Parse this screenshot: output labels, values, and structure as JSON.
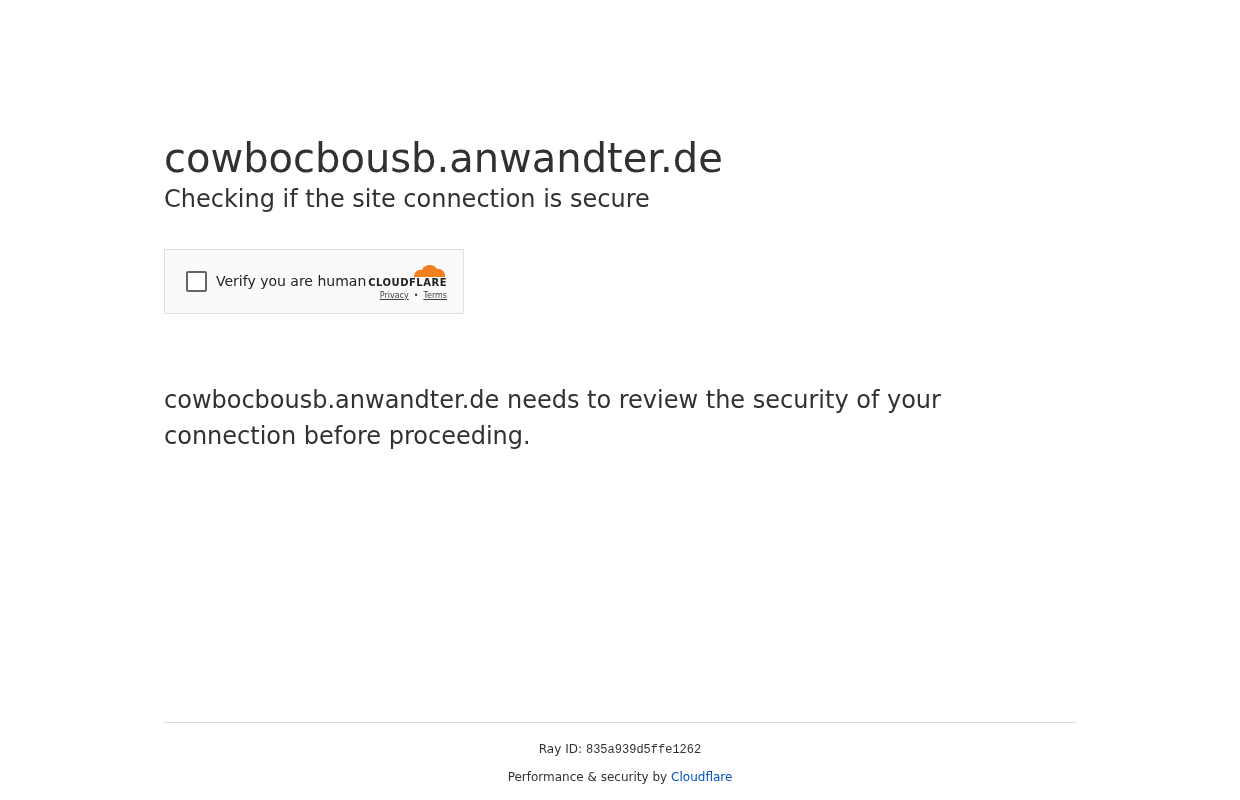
{
  "heading": "cowbocbousb.anwandter.de",
  "subheading": "Checking if the site connection is secure",
  "widget": {
    "checkbox": {
      "label": "Verify you are human",
      "checked": false
    },
    "logo_text": "CLOUDFLARE",
    "links": [
      "Privacy",
      "Terms"
    ],
    "separator": "•"
  },
  "message": "cowbocbousb.anwandter.de needs to review the security of your connection before proceeding.",
  "footer": {
    "ray_label": "Ray ID:",
    "ray_id": "835a939d5ffe1262",
    "credit": "Performance & security by",
    "credit_link": "Cloudflare"
  }
}
